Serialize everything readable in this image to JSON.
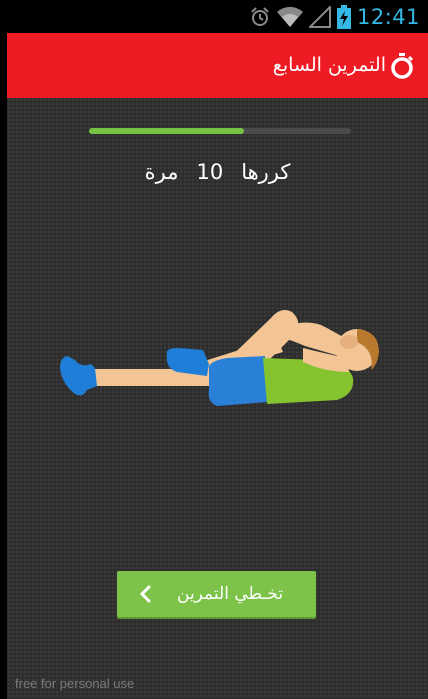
{
  "status_bar": {
    "time": "12:41",
    "icons": [
      "alarm-icon",
      "wifi-icon",
      "signal-icon",
      "battery-charging-icon"
    ]
  },
  "header": {
    "title": "التمرين السابع",
    "icon": "stopwatch-icon",
    "background": "#ee1b24"
  },
  "exercise": {
    "progress_fraction": 0.59,
    "progress_color": "#76c043",
    "repeat_label": "كررها",
    "count": "10",
    "unit": "مرة",
    "illustration": "knee-to-chest-stretch"
  },
  "skip_button": {
    "label": "تخـطي التمرين",
    "icon": "chevron-left-icon",
    "background": "#7dc34a"
  },
  "watermark": "free for personal use"
}
